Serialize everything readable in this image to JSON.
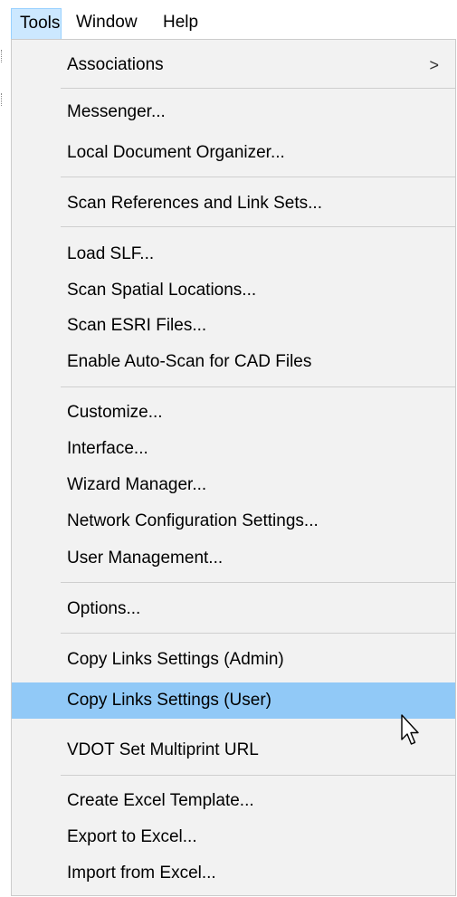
{
  "menubar": {
    "items": [
      "Tools",
      "Window",
      "Help"
    ]
  },
  "tools_menu": {
    "items": [
      {
        "label": "Associations",
        "submenu_arrow": ">"
      },
      {
        "label": "Messenger..."
      },
      {
        "label": "Local Document Organizer..."
      },
      {
        "label": "Scan References and Link Sets..."
      },
      {
        "label": "Load SLF..."
      },
      {
        "label": "Scan Spatial Locations..."
      },
      {
        "label": "Scan ESRI Files..."
      },
      {
        "label": "Enable Auto-Scan for CAD Files"
      },
      {
        "label": "Customize..."
      },
      {
        "label": "Interface..."
      },
      {
        "label": "Wizard Manager..."
      },
      {
        "label": "Network Configuration Settings..."
      },
      {
        "label": "User Management..."
      },
      {
        "label": "Options..."
      },
      {
        "label": "Copy Links Settings (Admin)"
      },
      {
        "label": "Copy Links Settings (User)",
        "highlighted": true
      },
      {
        "label": "VDOT Set Multiprint URL"
      },
      {
        "label": "Create Excel Template..."
      },
      {
        "label": "Export to Excel..."
      },
      {
        "label": "Import from Excel..."
      }
    ]
  },
  "colors": {
    "menu_background": "#f2f2f2",
    "highlight": "#91c9f7",
    "menubar_active": "#cce8ff",
    "separator": "#cfcfcf"
  },
  "icons": {
    "cursor": "mouse-pointer-icon",
    "submenu": "chevron-right-icon"
  }
}
